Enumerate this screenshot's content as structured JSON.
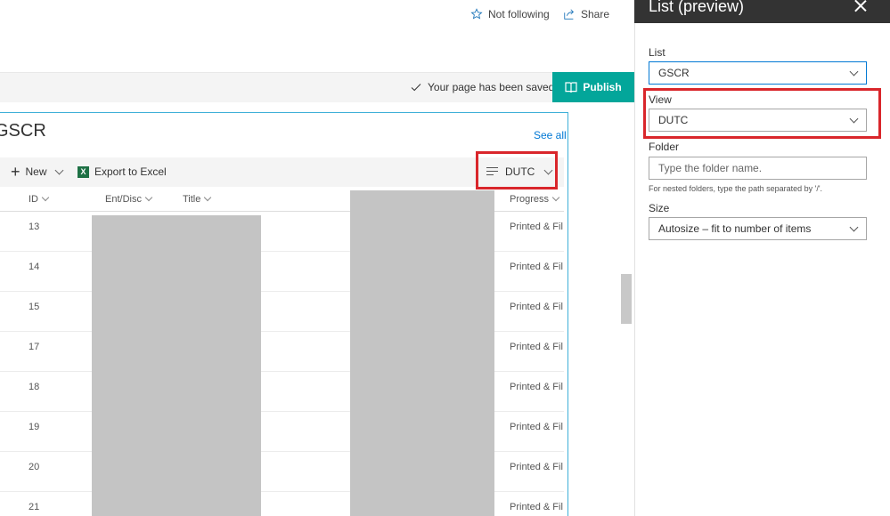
{
  "topbar": {
    "follow_icon": "star-icon",
    "follow_label": "Not following",
    "share_icon": "share-icon",
    "share_label": "Share"
  },
  "commandbar": {
    "saved_icon": "checkmark-icon",
    "saved_text": "Your page has been saved",
    "publish_icon": "book-icon",
    "publish_label": "Publish"
  },
  "webpart": {
    "title": "GSCR",
    "see_all": "See all",
    "toolbar": {
      "new_label": "New",
      "excel_label": "Export to Excel",
      "view_label": "DUTC"
    },
    "columns": [
      "ID",
      "Ent/Disc",
      "Title",
      "Progress"
    ],
    "rows": [
      {
        "id": "13",
        "progress": "Printed & Filed"
      },
      {
        "id": "14",
        "progress": "Printed & Filed"
      },
      {
        "id": "15",
        "progress": "Printed & Filed"
      },
      {
        "id": "17",
        "progress": "Printed & Filed"
      },
      {
        "id": "18",
        "progress": "Printed & Filed"
      },
      {
        "id": "19",
        "progress": "Printed & Filed"
      },
      {
        "id": "20",
        "progress": "Printed & Filed"
      },
      {
        "id": "21",
        "progress": "Printed & Filed"
      }
    ]
  },
  "panel": {
    "title": "List (preview)",
    "list_label": "List",
    "list_value": "GSCR",
    "view_label": "View",
    "view_value": "DUTC",
    "folder_label": "Folder",
    "folder_placeholder": "Type the folder name.",
    "folder_hint": "For nested folders, type the path separated by '/'.",
    "size_label": "Size",
    "size_value": "Autosize – fit to number of items"
  },
  "colors": {
    "accent": "#03a69a",
    "link": "#0078d4",
    "highlight": "#d9262b",
    "panel_header": "#333333"
  }
}
